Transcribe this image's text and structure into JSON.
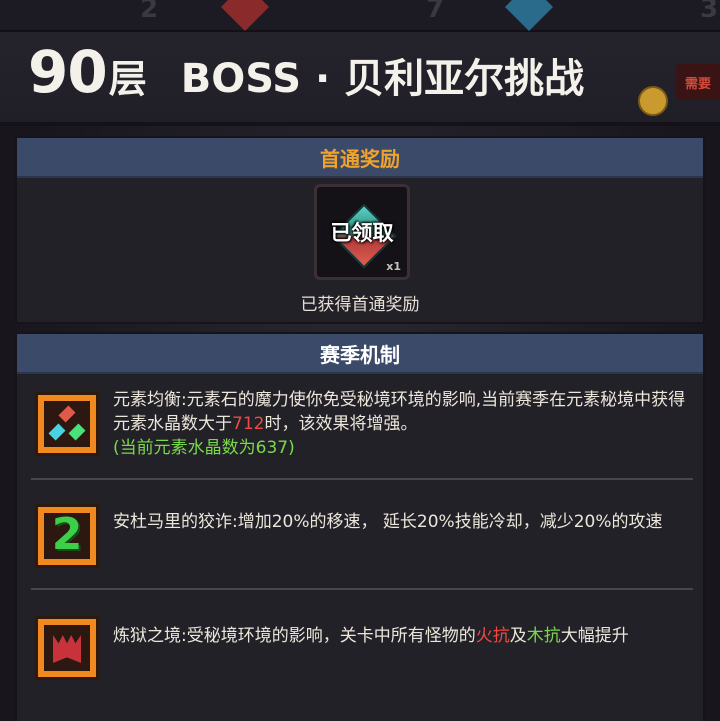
{
  "header": {
    "floor_number": "90",
    "floor_unit": "层",
    "boss_title": "BOSS · 贝利亚尔挑战",
    "strip_numbers": [
      "2",
      "7",
      "3"
    ],
    "side_badge": "需要"
  },
  "first_clear": {
    "heading": "首通奖励",
    "item": {
      "icon": "elemental-crystal-icon",
      "status": "已领取",
      "count": "x1"
    },
    "caption": "已获得首通奖励"
  },
  "season": {
    "heading": "赛季机制",
    "mechanics": [
      {
        "icon": "elemental-crystals-icon",
        "text_before": "元素均衡:元素石的魔力使你免受秘境环境的影响,当前赛季在元素秘境中获得元素水晶数大于",
        "threshold": "712",
        "text_after": "时，该效果将增强。",
        "status": "(当前元素水晶数为637)"
      },
      {
        "icon": "number-two-icon",
        "text": "安杜马里的狡诈:增加20%的移速， 延长20%技能冷却，减少20%的攻速"
      },
      {
        "icon": "demon-claw-icon",
        "text_before": "炼狱之境:受秘境环境的影响，关卡中所有怪物的",
        "fire_res": "火抗",
        "joiner": "及",
        "wood_res": "木抗",
        "text_after": "大幅提升"
      }
    ]
  },
  "colors": {
    "section_header": "#3c4a6a",
    "reward_heading": "#f0a22a",
    "highlight_red": "#f04a40",
    "highlight_green": "#7ad94a",
    "icon_frame": "#f08a20"
  }
}
